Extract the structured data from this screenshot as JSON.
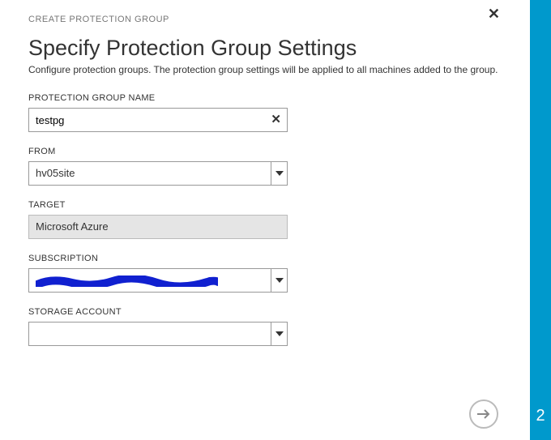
{
  "header": {
    "breadcrumb": "CREATE PROTECTION GROUP",
    "title": "Specify Protection Group Settings",
    "description": "Configure protection groups. The protection group settings will be applied to all machines added to the group."
  },
  "fields": {
    "name": {
      "label": "PROTECTION GROUP NAME",
      "value": "testpg"
    },
    "from": {
      "label": "FROM",
      "value": "hv05site"
    },
    "target": {
      "label": "TARGET",
      "value": "Microsoft Azure"
    },
    "subscription": {
      "label": "SUBSCRIPTION",
      "value": ""
    },
    "storage": {
      "label": "STORAGE ACCOUNT",
      "value": ""
    }
  },
  "nav": {
    "step": "2"
  },
  "redaction_color": "#1020d0"
}
